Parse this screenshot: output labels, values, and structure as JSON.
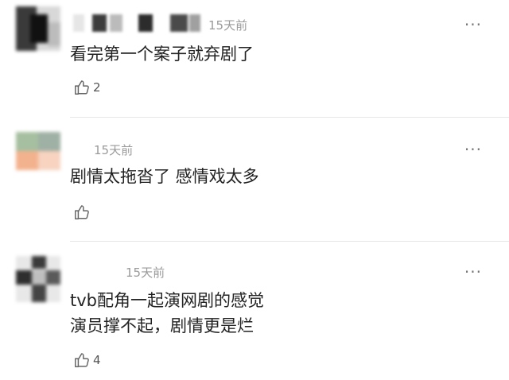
{
  "comments": [
    {
      "time": "15天前",
      "text": "看完第一个案子就弃剧了",
      "likes": "2",
      "icon": "thumbs-up-icon",
      "more_icon": "more-options-icon"
    },
    {
      "time": "15天前",
      "text": "剧情太拖沓了 感情戏太多",
      "likes": "",
      "icon": "thumbs-up-icon",
      "more_icon": "more-options-icon"
    },
    {
      "time": "15天前",
      "text_lines": [
        "tvb配角一起演网剧的感觉",
        "演员撑不起，剧情更是烂"
      ],
      "likes": "4",
      "icon": "thumbs-up-icon",
      "more_icon": "more-options-icon"
    }
  ],
  "more_glyph": "···"
}
